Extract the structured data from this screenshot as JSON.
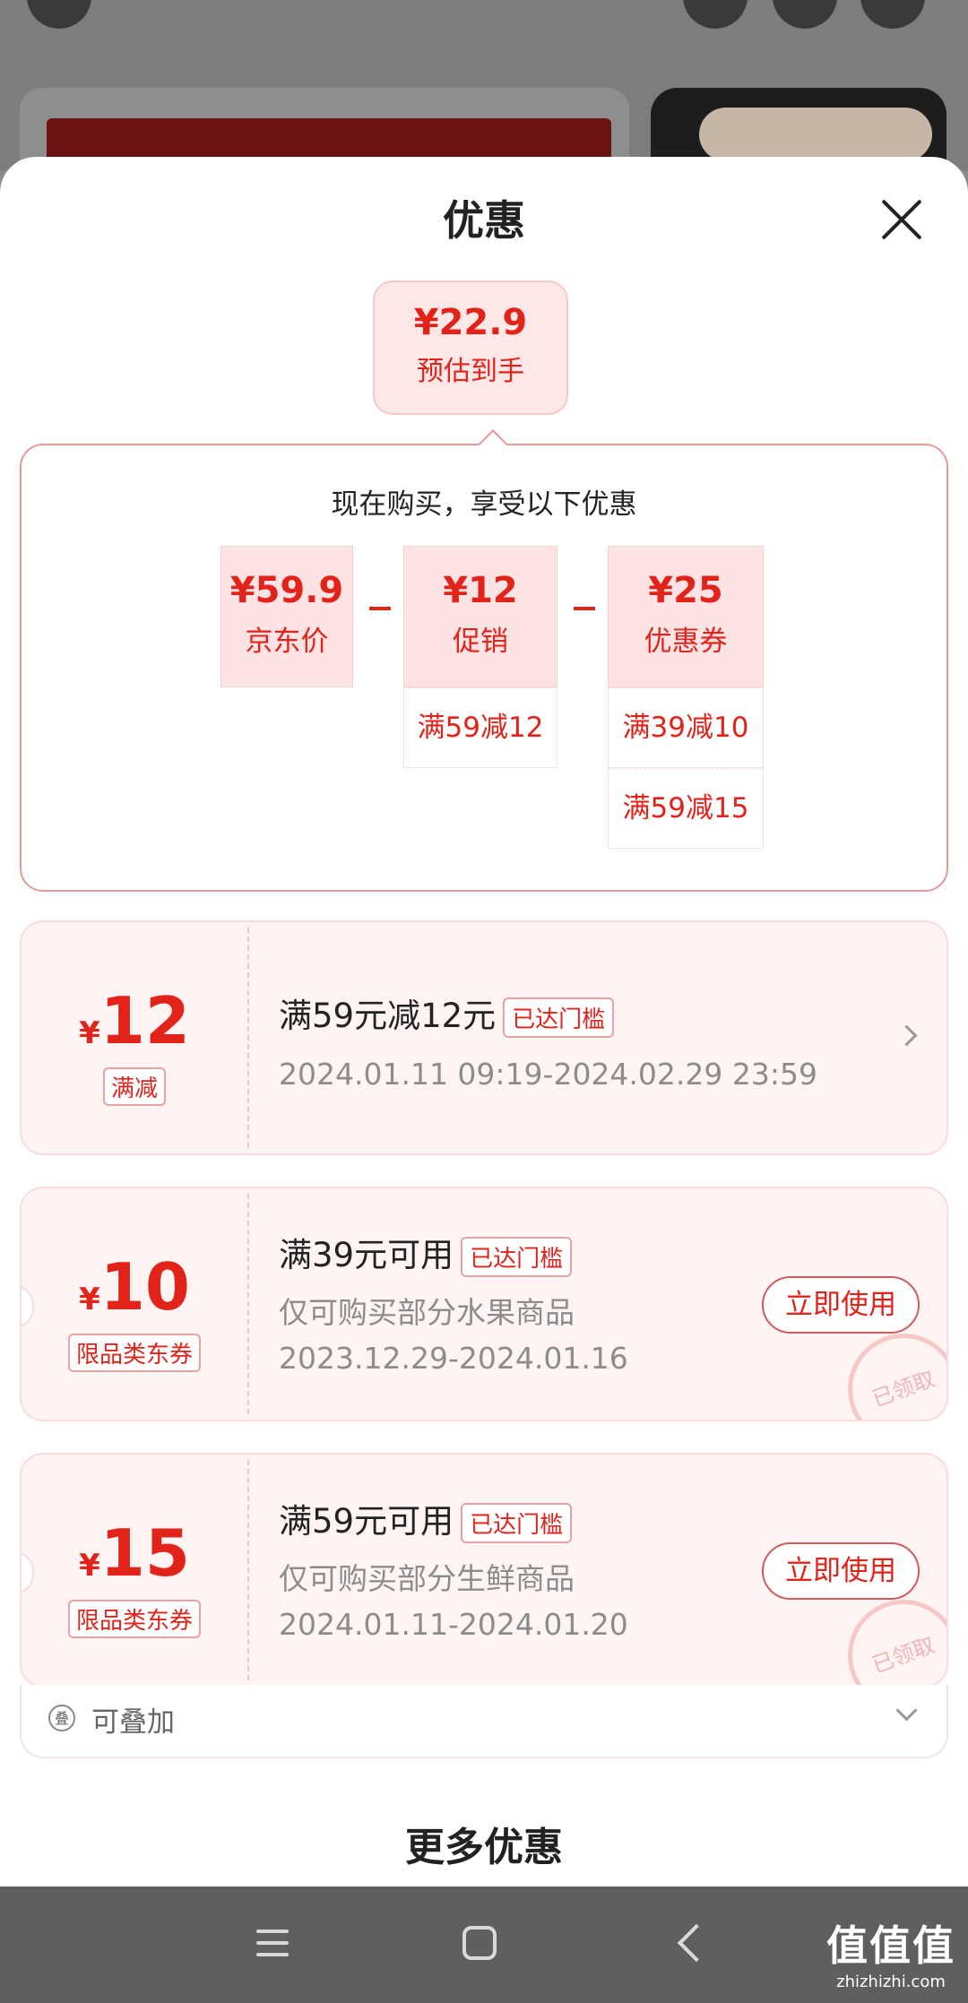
{
  "sheet": {
    "title": "优惠"
  },
  "estimate": {
    "price": "¥22.9",
    "label": "预估到手"
  },
  "summary": {
    "heading": "现在购买，享受以下优惠",
    "jd_price": {
      "value": "¥59.9",
      "label": "京东价"
    },
    "promo": {
      "value": "¥12",
      "label": "促销",
      "items": [
        "满59减12"
      ]
    },
    "coupon": {
      "value": "¥25",
      "label": "优惠券",
      "items": [
        "满39减10",
        "满59减15"
      ]
    }
  },
  "coupons": [
    {
      "yen": "¥",
      "amount": "12",
      "tag": "满减",
      "title": "满59元减12元",
      "badge": "已达门槛",
      "lines": [
        "2024.01.11 09:19-2024.02.29 23:59"
      ]
    },
    {
      "yen": "¥",
      "amount": "10",
      "tag": "限品类东券",
      "title": "满39元可用",
      "badge": "已达门槛",
      "lines": [
        "仅可购买部分水果商品",
        "2023.12.29-2024.01.16"
      ],
      "button": "立即使用",
      "stamp": "已领取"
    },
    {
      "yen": "¥",
      "amount": "15",
      "tag": "限品类东券",
      "title": "满59元可用",
      "badge": "已达门槛",
      "lines": [
        "仅可购买部分生鲜商品",
        "2024.01.11-2024.01.20"
      ],
      "button": "立即使用",
      "stamp": "已领取"
    }
  ],
  "stackable": {
    "icon_glyph": "叠",
    "label": "可叠加"
  },
  "more": {
    "title": "更多优惠"
  },
  "watermark": {
    "main": "值值值",
    "sub": "zhizhizhi.com"
  },
  "colors": {
    "accent": "#e2231a",
    "coupon_bg": "#fff4f4"
  }
}
